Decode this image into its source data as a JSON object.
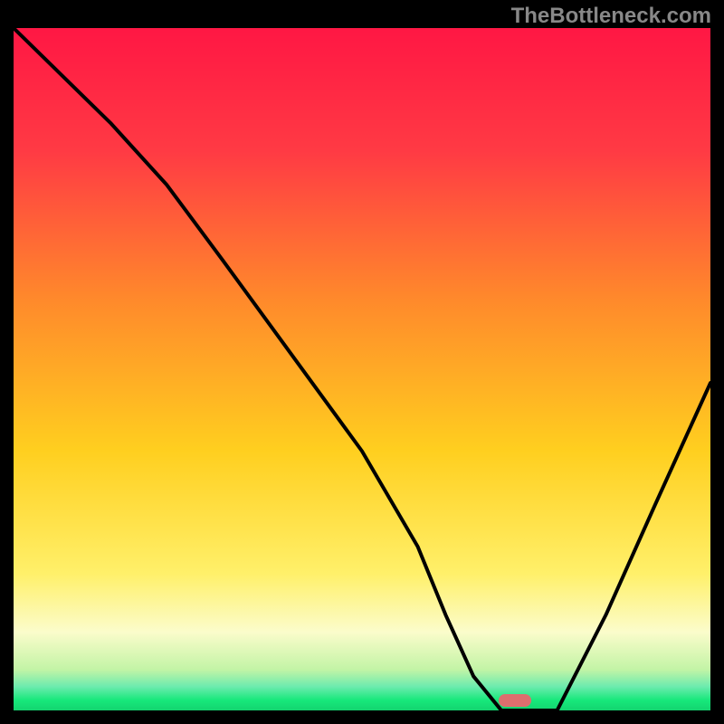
{
  "attribution": "TheBottleneck.com",
  "colors": {
    "top": "#ff1744",
    "mid_upper": "#ff6d2e",
    "mid": "#ffd21f",
    "mid_lower": "#fff06a",
    "pale_band": "#fbfccb",
    "green": "#17e87b",
    "marker": "#de6e6e",
    "line": "#000000",
    "frame": "#000000"
  },
  "chart_data": {
    "type": "line",
    "title": "",
    "xlabel": "",
    "ylabel": "",
    "xlim": [
      0,
      100
    ],
    "ylim": [
      0,
      100
    ],
    "x": [
      0,
      14,
      22,
      30,
      40,
      50,
      58,
      62,
      66,
      70,
      74,
      78,
      85,
      92,
      100
    ],
    "values": [
      100,
      86,
      77,
      66,
      52,
      38,
      24,
      14,
      5,
      0,
      0,
      0,
      14,
      30,
      48
    ],
    "optimum_x": 72,
    "marker_x": 72,
    "marker_y": 0
  }
}
